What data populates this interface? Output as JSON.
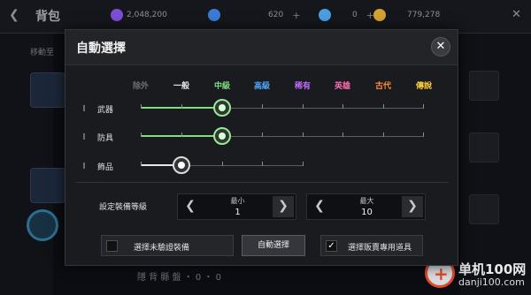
{
  "background": {
    "title": "背包",
    "back_icon": "arrow-left-icon",
    "left_label": "移動至",
    "currencies": [
      {
        "value": "2,048,200",
        "color": "#7b4fd6",
        "icon": "gem-icon"
      },
      {
        "value": "620",
        "color": "#3a7bd5",
        "icon": "crystal-icon"
      },
      {
        "value": "0",
        "color": "#4a9fe0",
        "icon": "diamond-icon"
      },
      {
        "value": "779,278",
        "color": "#d4a232",
        "icon": "gold-coin-icon"
      }
    ],
    "bottom_text": "隱 背 縣 盤 ・ 0 ・ 0"
  },
  "dialog": {
    "title": "自動選擇",
    "close_icon": "close-icon",
    "grades": [
      {
        "label": "除外",
        "color": "#6e7076"
      },
      {
        "label": "一般",
        "color": "#e8e8e8"
      },
      {
        "label": "中級",
        "color": "#7fe07f"
      },
      {
        "label": "高級",
        "color": "#4fa8ff"
      },
      {
        "label": "稀有",
        "color": "#c36bff"
      },
      {
        "label": "英雄",
        "color": "#ff6bb5"
      },
      {
        "label": "古代",
        "color": "#ff8c3a"
      },
      {
        "label": "傳說",
        "color": "#ffd23a"
      }
    ],
    "sliders": [
      {
        "label": "武器",
        "selected_index": 2,
        "max_index": 7
      },
      {
        "label": "防具",
        "selected_index": 2,
        "max_index": 7
      },
      {
        "label": "飾品",
        "selected_index": 1,
        "max_index": 4
      }
    ],
    "equip_level": {
      "label": "設定裝備等級",
      "min": {
        "caption": "最小",
        "value": "1"
      },
      "max": {
        "caption": "最大",
        "value": "10"
      }
    },
    "options": {
      "unverified_label": "選擇未驗證裝備",
      "unverified_checked": false,
      "auto_select_label": "自動選擇",
      "sell_only_label": "選擇販賣專用道具",
      "sell_only_checked": true
    }
  },
  "watermark": {
    "name": "单机100网",
    "url": "danji100.com"
  }
}
